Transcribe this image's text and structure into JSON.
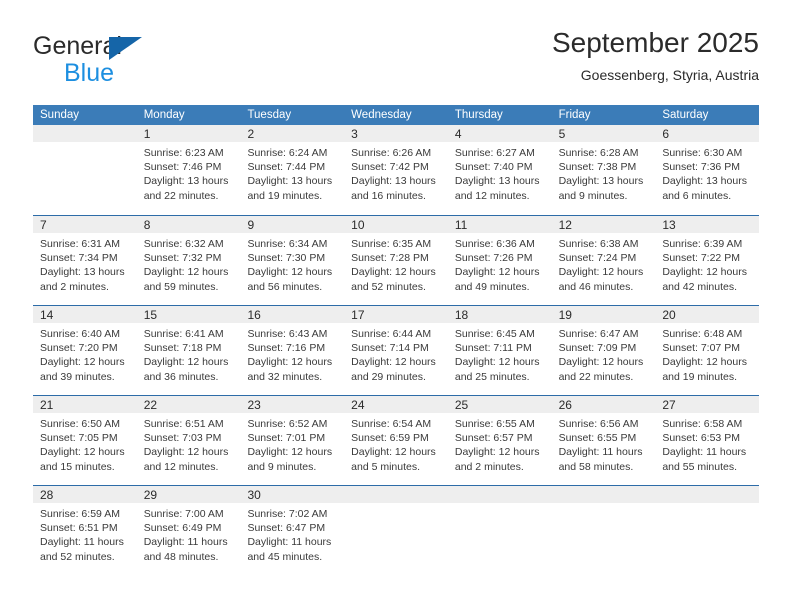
{
  "brand": {
    "line1": "General",
    "line2": "Blue",
    "accent": "#1d8fe0",
    "triangle_color": "#1565a8"
  },
  "header": {
    "title": "September 2025",
    "subtitle": "Goessenberg, Styria, Austria"
  },
  "theme": {
    "header_bg": "#3b7cb8",
    "week_divider": "#2d6ca8",
    "day_band_bg": "#eeeeee",
    "text": "#2b2b2b"
  },
  "calendar": {
    "weekdays": [
      "Sunday",
      "Monday",
      "Tuesday",
      "Wednesday",
      "Thursday",
      "Friday",
      "Saturday"
    ],
    "weeks": [
      [
        {
          "day": "",
          "lines": []
        },
        {
          "day": "1",
          "lines": [
            "Sunrise: 6:23 AM",
            "Sunset: 7:46 PM",
            "Daylight: 13 hours",
            "and 22 minutes."
          ]
        },
        {
          "day": "2",
          "lines": [
            "Sunrise: 6:24 AM",
            "Sunset: 7:44 PM",
            "Daylight: 13 hours",
            "and 19 minutes."
          ]
        },
        {
          "day": "3",
          "lines": [
            "Sunrise: 6:26 AM",
            "Sunset: 7:42 PM",
            "Daylight: 13 hours",
            "and 16 minutes."
          ]
        },
        {
          "day": "4",
          "lines": [
            "Sunrise: 6:27 AM",
            "Sunset: 7:40 PM",
            "Daylight: 13 hours",
            "and 12 minutes."
          ]
        },
        {
          "day": "5",
          "lines": [
            "Sunrise: 6:28 AM",
            "Sunset: 7:38 PM",
            "Daylight: 13 hours",
            "and 9 minutes."
          ]
        },
        {
          "day": "6",
          "lines": [
            "Sunrise: 6:30 AM",
            "Sunset: 7:36 PM",
            "Daylight: 13 hours",
            "and 6 minutes."
          ]
        }
      ],
      [
        {
          "day": "7",
          "lines": [
            "Sunrise: 6:31 AM",
            "Sunset: 7:34 PM",
            "Daylight: 13 hours",
            "and 2 minutes."
          ]
        },
        {
          "day": "8",
          "lines": [
            "Sunrise: 6:32 AM",
            "Sunset: 7:32 PM",
            "Daylight: 12 hours",
            "and 59 minutes."
          ]
        },
        {
          "day": "9",
          "lines": [
            "Sunrise: 6:34 AM",
            "Sunset: 7:30 PM",
            "Daylight: 12 hours",
            "and 56 minutes."
          ]
        },
        {
          "day": "10",
          "lines": [
            "Sunrise: 6:35 AM",
            "Sunset: 7:28 PM",
            "Daylight: 12 hours",
            "and 52 minutes."
          ]
        },
        {
          "day": "11",
          "lines": [
            "Sunrise: 6:36 AM",
            "Sunset: 7:26 PM",
            "Daylight: 12 hours",
            "and 49 minutes."
          ]
        },
        {
          "day": "12",
          "lines": [
            "Sunrise: 6:38 AM",
            "Sunset: 7:24 PM",
            "Daylight: 12 hours",
            "and 46 minutes."
          ]
        },
        {
          "day": "13",
          "lines": [
            "Sunrise: 6:39 AM",
            "Sunset: 7:22 PM",
            "Daylight: 12 hours",
            "and 42 minutes."
          ]
        }
      ],
      [
        {
          "day": "14",
          "lines": [
            "Sunrise: 6:40 AM",
            "Sunset: 7:20 PM",
            "Daylight: 12 hours",
            "and 39 minutes."
          ]
        },
        {
          "day": "15",
          "lines": [
            "Sunrise: 6:41 AM",
            "Sunset: 7:18 PM",
            "Daylight: 12 hours",
            "and 36 minutes."
          ]
        },
        {
          "day": "16",
          "lines": [
            "Sunrise: 6:43 AM",
            "Sunset: 7:16 PM",
            "Daylight: 12 hours",
            "and 32 minutes."
          ]
        },
        {
          "day": "17",
          "lines": [
            "Sunrise: 6:44 AM",
            "Sunset: 7:14 PM",
            "Daylight: 12 hours",
            "and 29 minutes."
          ]
        },
        {
          "day": "18",
          "lines": [
            "Sunrise: 6:45 AM",
            "Sunset: 7:11 PM",
            "Daylight: 12 hours",
            "and 25 minutes."
          ]
        },
        {
          "day": "19",
          "lines": [
            "Sunrise: 6:47 AM",
            "Sunset: 7:09 PM",
            "Daylight: 12 hours",
            "and 22 minutes."
          ]
        },
        {
          "day": "20",
          "lines": [
            "Sunrise: 6:48 AM",
            "Sunset: 7:07 PM",
            "Daylight: 12 hours",
            "and 19 minutes."
          ]
        }
      ],
      [
        {
          "day": "21",
          "lines": [
            "Sunrise: 6:50 AM",
            "Sunset: 7:05 PM",
            "Daylight: 12 hours",
            "and 15 minutes."
          ]
        },
        {
          "day": "22",
          "lines": [
            "Sunrise: 6:51 AM",
            "Sunset: 7:03 PM",
            "Daylight: 12 hours",
            "and 12 minutes."
          ]
        },
        {
          "day": "23",
          "lines": [
            "Sunrise: 6:52 AM",
            "Sunset: 7:01 PM",
            "Daylight: 12 hours",
            "and 9 minutes."
          ]
        },
        {
          "day": "24",
          "lines": [
            "Sunrise: 6:54 AM",
            "Sunset: 6:59 PM",
            "Daylight: 12 hours",
            "and 5 minutes."
          ]
        },
        {
          "day": "25",
          "lines": [
            "Sunrise: 6:55 AM",
            "Sunset: 6:57 PM",
            "Daylight: 12 hours",
            "and 2 minutes."
          ]
        },
        {
          "day": "26",
          "lines": [
            "Sunrise: 6:56 AM",
            "Sunset: 6:55 PM",
            "Daylight: 11 hours",
            "and 58 minutes."
          ]
        },
        {
          "day": "27",
          "lines": [
            "Sunrise: 6:58 AM",
            "Sunset: 6:53 PM",
            "Daylight: 11 hours",
            "and 55 minutes."
          ]
        }
      ],
      [
        {
          "day": "28",
          "lines": [
            "Sunrise: 6:59 AM",
            "Sunset: 6:51 PM",
            "Daylight: 11 hours",
            "and 52 minutes."
          ]
        },
        {
          "day": "29",
          "lines": [
            "Sunrise: 7:00 AM",
            "Sunset: 6:49 PM",
            "Daylight: 11 hours",
            "and 48 minutes."
          ]
        },
        {
          "day": "30",
          "lines": [
            "Sunrise: 7:02 AM",
            "Sunset: 6:47 PM",
            "Daylight: 11 hours",
            "and 45 minutes."
          ]
        },
        {
          "day": "",
          "lines": []
        },
        {
          "day": "",
          "lines": []
        },
        {
          "day": "",
          "lines": []
        },
        {
          "day": "",
          "lines": []
        }
      ]
    ]
  }
}
